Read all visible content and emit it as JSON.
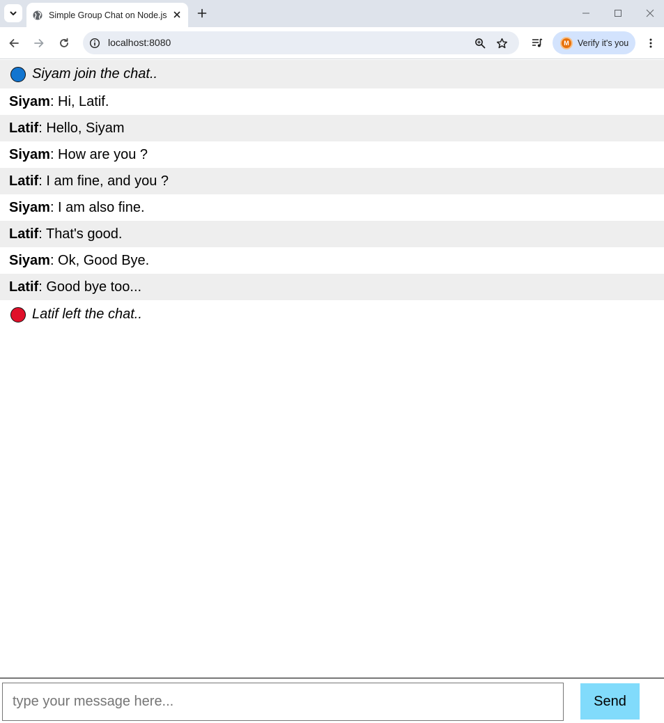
{
  "browser": {
    "tab": {
      "title": "Simple Group Chat on Node.js",
      "favicon": "globe-icon"
    },
    "address": {
      "url": "localhost:8080"
    },
    "profile": {
      "label": "Verify it's you",
      "avatar_initial": "M"
    }
  },
  "chat": {
    "join_notice": {
      "text": "Siyam join the chat..",
      "dot_color": "#1275d0"
    },
    "messages": [
      {
        "sender": "Siyam",
        "text": ": Hi, Latif."
      },
      {
        "sender": "Latif",
        "text": ": Hello, Siyam"
      },
      {
        "sender": "Siyam",
        "text": ": How are you ?"
      },
      {
        "sender": "Latif",
        "text": ": I am fine, and you ?"
      },
      {
        "sender": "Siyam",
        "text": ": I am also fine."
      },
      {
        "sender": "Latif",
        "text": ": That's good."
      },
      {
        "sender": "Siyam",
        "text": ": Ok, Good Bye."
      },
      {
        "sender": "Latif",
        "text": ": Good bye too..."
      }
    ],
    "leave_notice": {
      "text": "Latif left the chat..",
      "dot_color": "#e0102a"
    }
  },
  "composer": {
    "placeholder": "type your message here...",
    "value": "",
    "send_label": "Send",
    "send_color": "#81dbfb"
  }
}
